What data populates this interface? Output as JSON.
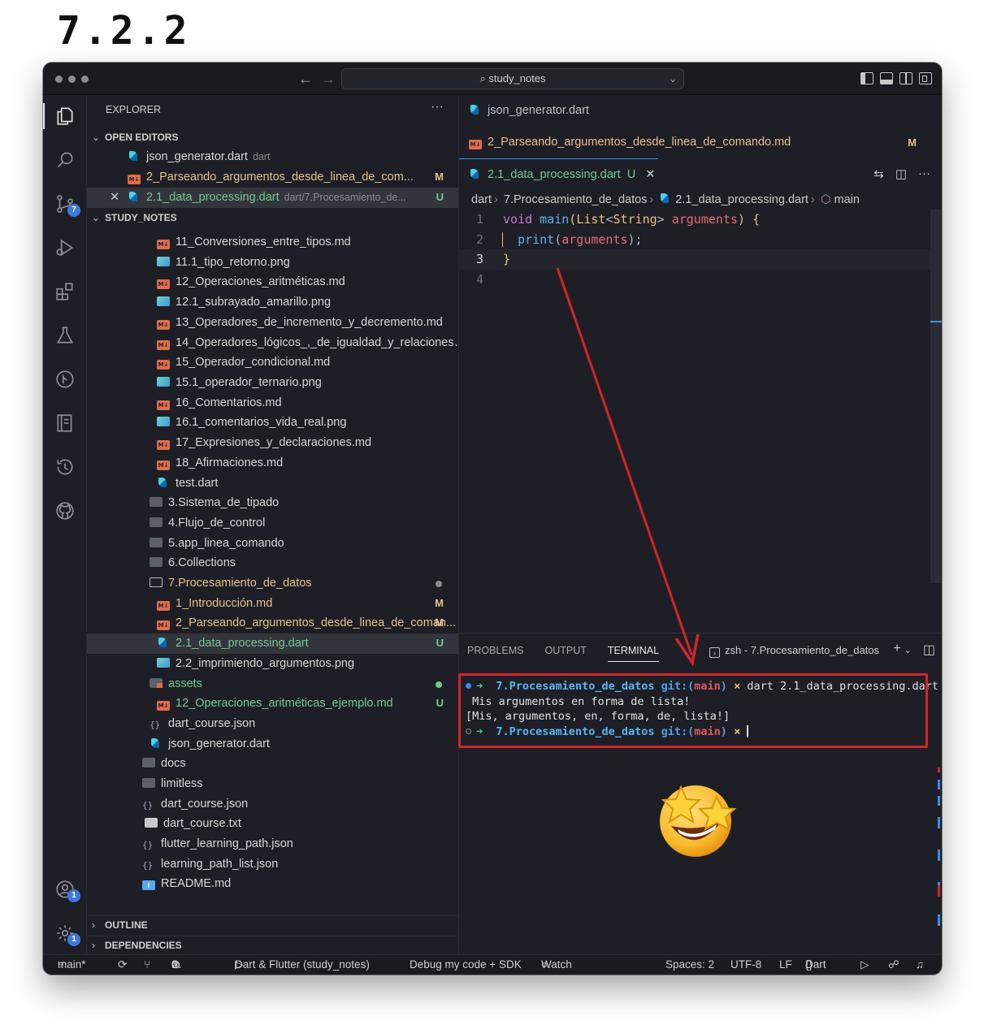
{
  "heading": "7.2.2",
  "titlebar": {
    "search_text": "study_notes"
  },
  "activity": {
    "scm_badge": "7",
    "accounts_badge": "1",
    "settings_badge": "1"
  },
  "explorer": {
    "title": "EXPLORER",
    "open_editors_label": "OPEN EDITORS",
    "open_editors": [
      {
        "name": "json_generator.dart",
        "desc": "dart",
        "status": ""
      },
      {
        "name": "2_Parseando_argumentos_desde_linea_de_com...",
        "desc": "",
        "status": "M"
      },
      {
        "name": "2.1_data_processing.dart",
        "desc": "dart/7.Procesamiento_de...",
        "status": "U"
      }
    ],
    "project_label": "STUDY_NOTES",
    "tree": [
      {
        "name": "11_Conversiones_entre_tipos.md",
        "status": ""
      },
      {
        "name": "11.1_tipo_retorno.png",
        "status": ""
      },
      {
        "name": "12_Operaciones_aritméticas.md",
        "status": ""
      },
      {
        "name": "12.1_subrayado_amarillo.png",
        "status": ""
      },
      {
        "name": "13_Operadores_de_incremento_y_decremento.md",
        "status": ""
      },
      {
        "name": "14_Operadores_lógicos_,_de_igualdad_y_relaciones.md",
        "status": ""
      },
      {
        "name": "15_Operador_condicional.md",
        "status": ""
      },
      {
        "name": "15.1_operador_ternario.png",
        "status": ""
      },
      {
        "name": "16_Comentarios.md",
        "status": ""
      },
      {
        "name": "16.1_comentarios_vida_real.png",
        "status": ""
      },
      {
        "name": "17_Expresiones_y_declaraciones.md",
        "status": ""
      },
      {
        "name": "18_Afirmaciones.md",
        "status": ""
      },
      {
        "name": "test.dart",
        "status": ""
      },
      {
        "name": "3.Sistema_de_tipado",
        "status": ""
      },
      {
        "name": "4.Flujo_de_control",
        "status": ""
      },
      {
        "name": "5.app_linea_comando",
        "status": ""
      },
      {
        "name": "6.Collections",
        "status": ""
      },
      {
        "name": "7.Procesamiento_de_datos",
        "status": ""
      },
      {
        "name": "1_Introducción.md",
        "status": "M"
      },
      {
        "name": "2_Parseando_argumentos_desde_linea_de_coman...",
        "status": "M"
      },
      {
        "name": "2.1_data_processing.dart",
        "status": "U"
      },
      {
        "name": "2.2_imprimiendo_argumentos.png",
        "status": ""
      },
      {
        "name": "assets",
        "status": ""
      },
      {
        "name": "12_Operaciones_aritméticas_ejemplo.md",
        "status": "U"
      },
      {
        "name": "dart_course.json",
        "status": ""
      },
      {
        "name": "json_generator.dart",
        "status": ""
      },
      {
        "name": "docs",
        "status": ""
      },
      {
        "name": "limitless",
        "status": ""
      },
      {
        "name": "dart_course.json",
        "status": ""
      },
      {
        "name": "dart_course.txt",
        "status": ""
      },
      {
        "name": "flutter_learning_path.json",
        "status": ""
      },
      {
        "name": "learning_path_list.json",
        "status": ""
      },
      {
        "name": "README.md",
        "status": ""
      }
    ],
    "outline_label": "OUTLINE",
    "dependencies_label": "DEPENDENCIES"
  },
  "editor": {
    "tabs": [
      {
        "name": "json_generator.dart",
        "status": ""
      },
      {
        "name": "2_Parseando_argumentos_desde_linea_de_comando.md",
        "status": "M"
      }
    ],
    "active_tab": {
      "name": "2.1_data_processing.dart",
      "status": "U"
    },
    "breadcrumb": [
      "dart",
      "7.Procesamiento_de_datos",
      "2.1_data_processing.dart",
      "main"
    ],
    "line_numbers": [
      "1",
      "2",
      "3",
      "4"
    ],
    "code": {
      "l1_void": "void",
      "l1_main": "main",
      "l1_open": "(",
      "l1_list": "List",
      "l1_lt": "<",
      "l1_string": "String",
      "l1_gt": ">",
      "l1_args": "arguments",
      "l1_close": ") ",
      "l1_brace": "{",
      "l2_print": "print",
      "l2_open": "(",
      "l2_args": "arguments",
      "l2_close": ");",
      "l3_brace": "}"
    }
  },
  "panel": {
    "tabs": [
      "PROBLEMS",
      "OUTPUT",
      "TERMINAL"
    ],
    "terminal_name": "zsh - 7.Procesamiento_de_datos",
    "prompt_dir": "7.Procesamiento_de_datos",
    "prompt_git": "git:(",
    "prompt_branch": "main",
    "prompt_git_close": ")",
    "prompt_x": "×",
    "command": "dart 2.1_data_processing.dart",
    "output_1": " Mis argumentos en forma de lista!",
    "output_2": "[Mis, argumentos, en, forma, de, lista!]"
  },
  "statusbar": {
    "branch": "main*",
    "errors": "0",
    "warnings": "0",
    "launch": "Dart & Flutter (study_notes)",
    "debug_mode": "Debug my code + SDK",
    "watch": "Watch",
    "spaces": "Spaces: 2",
    "encoding": "UTF-8",
    "eol": "LF",
    "language": "Dart"
  },
  "colors": {
    "highlight_red": "#d0262a",
    "accent_blue": "#3b8eea",
    "modified": "#e2c08d",
    "untracked": "#73c991"
  }
}
